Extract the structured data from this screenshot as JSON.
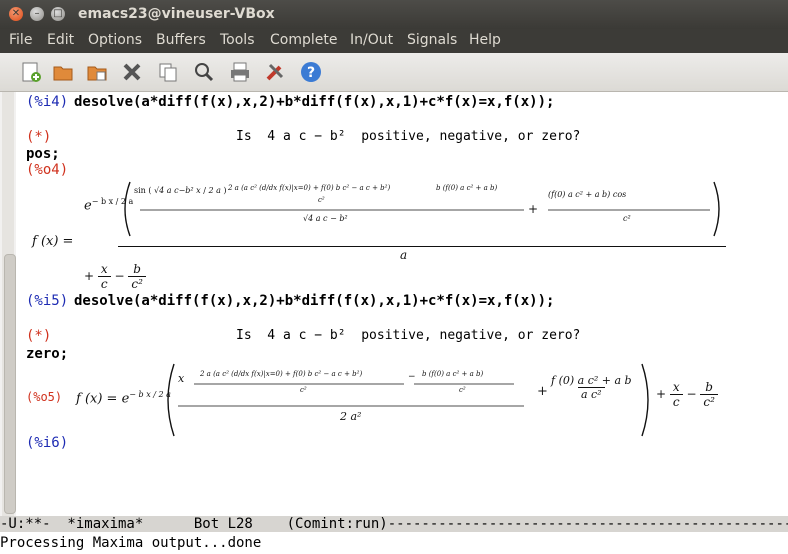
{
  "window": {
    "title": "emacs23@vineuser-VBox"
  },
  "menu": [
    "File",
    "Edit",
    "Options",
    "Buffers",
    "Tools",
    "Complete",
    "In/Out",
    "Signals",
    "Help"
  ],
  "toolbar_icons": [
    "new-file-icon",
    "open-folder-icon",
    "dired-icon",
    "close-buffer-icon",
    "copy-icon",
    "search-icon",
    "print-icon",
    "preferences-icon",
    "help-icon"
  ],
  "session": {
    "i4_label": "(%i4)",
    "i4_cmd": "desolve(a*diff(f(x),x,2)+b*diff(f(x),x,1)+c*f(x)=x,f(x));",
    "q1_label": "(*)",
    "q1_text": "Is  4 a c − b²  positive, negative, or zero?",
    "a1": "pos;",
    "o4_label": "(%o4)",
    "o4_lhs": "f (x) =",
    "o4_sin": "sin",
    "o4_sqrt": "√4 a c−b² x",
    "o4_2a": "2 a",
    "o4_inner": "2 a (a c² (d/dx f(x)|x=0) + f(0) b c² − a c + b²)",
    "o4_c2": "c²",
    "o4_bf": "b (f(0) a c² + a b)",
    "o4_sqrtden": "√4 a c − b²",
    "o4_cos": "(f(0) a c² + a b) cos",
    "o4_a": "a",
    "o4_tail": "+ x/c − b/c²",
    "o4_exp": "e",
    "o4_expsup": "− b x / 2 a",
    "i5_label": "(%i5)",
    "i5_cmd": "desolve(a*diff(f(x),x,2)+b*diff(f(x),x,1)+c*f(x)=x,f(x));",
    "q2_label": "(*)",
    "q2_text": "Is  4 a c − b²  positive, negative, or zero?",
    "a2": "zero;",
    "o5_label": "(%o5)",
    "o5_lhs": "f (x) = e",
    "o5_expsup": "− b x / 2 a",
    "o5_inner": "2 a (a c² (d/dx f(x)|x=0) + f(0) b c² − a c + b²)",
    "o5_c2": "c²",
    "o5_bf": "b (f(0) a c² + a b)",
    "o5_2a2": "2 a²",
    "o5_fnum": "f (0) a c² + a b",
    "o5_fden": "a c²",
    "o5_x": "x",
    "o5_tail": "+ x/c − b/c²",
    "i6_label": "(%i6)"
  },
  "modeline": "-U:**-  *imaxima*      Bot L28    (Comint:run)--------------------------------------------------",
  "echo": "Processing Maxima output...done"
}
